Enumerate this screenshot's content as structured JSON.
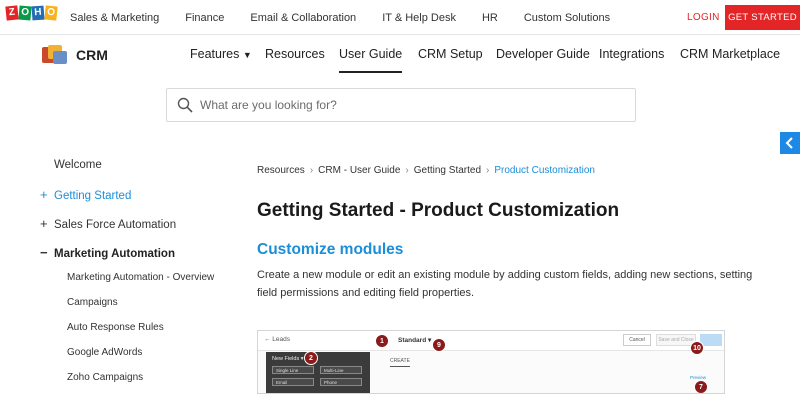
{
  "brand": {
    "logo_letters": [
      "Z",
      "O",
      "H",
      "O"
    ]
  },
  "topnav": {
    "items": [
      "Sales & Marketing",
      "Finance",
      "Email & Collaboration",
      "IT & Help Desk",
      "HR",
      "Custom Solutions"
    ],
    "login": "LOGIN",
    "get_started": "GET STARTED"
  },
  "header": {
    "product": "CRM",
    "nav": [
      "Features",
      "Resources",
      "User Guide",
      "CRM Setup",
      "Developer Guide",
      "Integrations",
      "CRM Marketplace"
    ],
    "active": "User Guide"
  },
  "search": {
    "placeholder": "What are you looking for?"
  },
  "sidebar": {
    "items": [
      {
        "label": "Welcome",
        "sign": ""
      },
      {
        "label": "Getting Started",
        "sign": "+"
      },
      {
        "label": "Sales Force Automation",
        "sign": "+"
      },
      {
        "label": "Marketing Automation",
        "sign": "−"
      }
    ],
    "subitems": [
      "Marketing Automation - Overview",
      "Campaigns",
      "Auto Response Rules",
      "Google AdWords",
      "Zoho Campaigns"
    ]
  },
  "breadcrumb": {
    "items": [
      "Resources",
      "CRM - User Guide",
      "Getting Started",
      "Product Customization"
    ]
  },
  "content": {
    "title": "Getting Started - Product Customization",
    "section": "Customize modules",
    "paragraph": "Create a new module or edit an existing module by adding custom fields, adding new sections, setting field permissions and editing field properties."
  },
  "figure": {
    "back": "← Leads",
    "layout": "Standard ▾",
    "cancel": "Cancel",
    "save_and_close": "Save and Close",
    "new_fields": "New Fields ▾",
    "chips": [
      "Single Line",
      "Multi-Line",
      "Email",
      "Phone"
    ],
    "create": "CREATE",
    "preview": "Preview",
    "badges": [
      "1",
      "2",
      "9",
      "10",
      "7"
    ]
  },
  "colors": {
    "accent": "#1b8ed8",
    "brand_red": "#e42527",
    "side_tab": "#1e88e5",
    "badge": "#8b1a1a"
  }
}
